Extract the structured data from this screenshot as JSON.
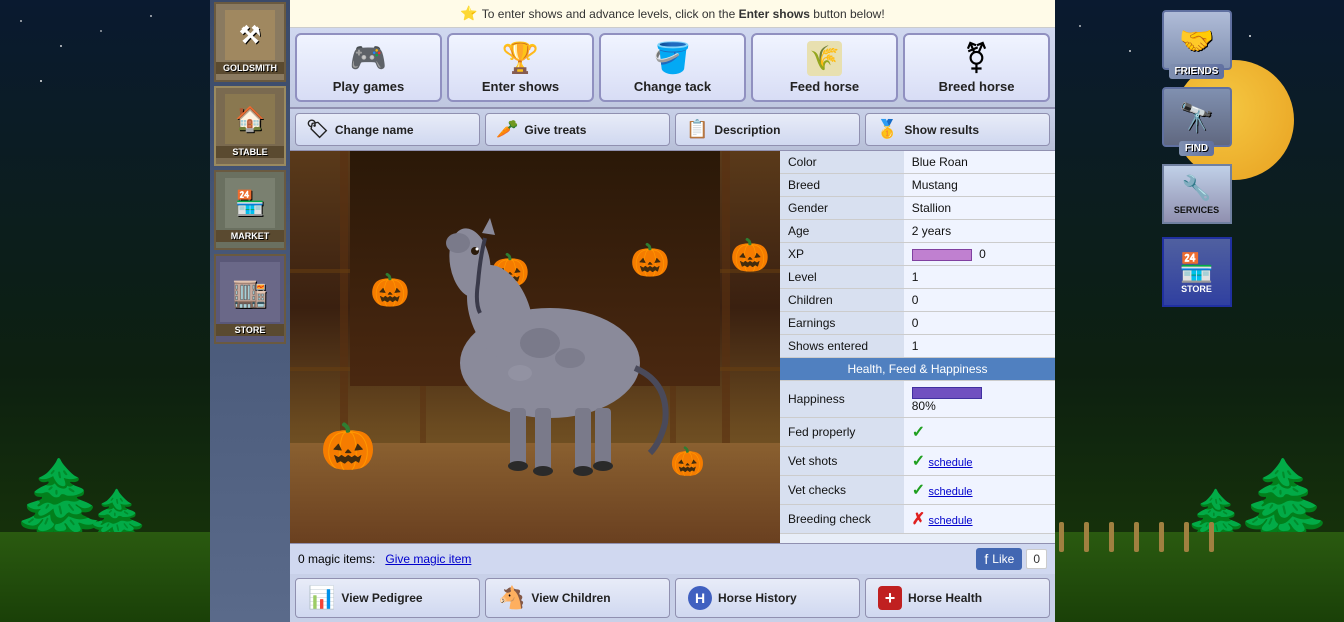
{
  "background": {
    "sky_color": "#0a1520",
    "grass_color": "#2a5a10"
  },
  "notification": {
    "text_before": "To enter shows and advance levels, click on the",
    "highlight": "Enter shows",
    "text_after": "button below!"
  },
  "action_buttons": [
    {
      "id": "play-games",
      "label": "Play games",
      "icon": "🎮"
    },
    {
      "id": "enter-shows",
      "label": "Enter shows",
      "icon": "🏆"
    },
    {
      "id": "change-tack",
      "label": "Change tack",
      "icon": "🪣"
    },
    {
      "id": "feed-horse",
      "label": "Feed horse",
      "icon": "🌾"
    },
    {
      "id": "breed-horse",
      "label": "Breed horse",
      "icon": "♀"
    }
  ],
  "secondary_actions": [
    {
      "id": "change-name",
      "label": "Change name",
      "icon": "🏷"
    },
    {
      "id": "give-treats",
      "label": "Give treats",
      "icon": "🥕"
    },
    {
      "id": "description",
      "label": "Description",
      "icon": "📋"
    },
    {
      "id": "show-results",
      "label": "Show results",
      "icon": "🥇"
    }
  ],
  "horse": {
    "color": "Blue Roan",
    "breed": "Mustang",
    "gender": "Stallion",
    "age": "2 years",
    "xp": "0",
    "level": "1",
    "children": "0",
    "earnings": "0",
    "shows_entered": "1",
    "happiness_pct": "80%",
    "fed_properly": true,
    "vet_shots": true,
    "vet_checks": true,
    "breeding_check": false
  },
  "stats_labels": {
    "color": "Color",
    "breed": "Breed",
    "gender": "Gender",
    "age": "Age",
    "xp": "XP",
    "level": "Level",
    "children": "Children",
    "earnings": "Earnings",
    "shows_entered": "Shows entered",
    "health_header": "Health, Feed & Happiness",
    "happiness": "Happiness",
    "fed_properly": "Fed properly",
    "vet_shots": "Vet shots",
    "vet_checks": "Vet checks",
    "breeding_check": "Breeding check",
    "schedule": "schedule"
  },
  "bottom": {
    "magic_items": "0 magic items:",
    "give_magic_link": "Give magic item",
    "like_count": "0"
  },
  "bottom_buttons": [
    {
      "id": "view-pedigree",
      "label": "View Pedigree",
      "icon": "📊"
    },
    {
      "id": "view-children",
      "label": "View Children",
      "icon": "🐴"
    },
    {
      "id": "horse-history",
      "label": "Horse History",
      "icon": "🔵"
    },
    {
      "id": "horse-health",
      "label": "Horse Health",
      "icon": "➕"
    }
  ],
  "buildings": [
    {
      "id": "goldsmith",
      "label": "GOLDSMITH",
      "icon": "⚒"
    },
    {
      "id": "stable",
      "label": "STABLE",
      "icon": "🏠"
    },
    {
      "id": "market",
      "label": "MARKET",
      "icon": "🏪"
    },
    {
      "id": "store",
      "label": "STORE",
      "icon": "🏬"
    }
  ],
  "right_panel": {
    "friends_label": "FRIENDS",
    "find_label": "FIND",
    "services_label": "SERVICES",
    "store_label": "STORE"
  }
}
